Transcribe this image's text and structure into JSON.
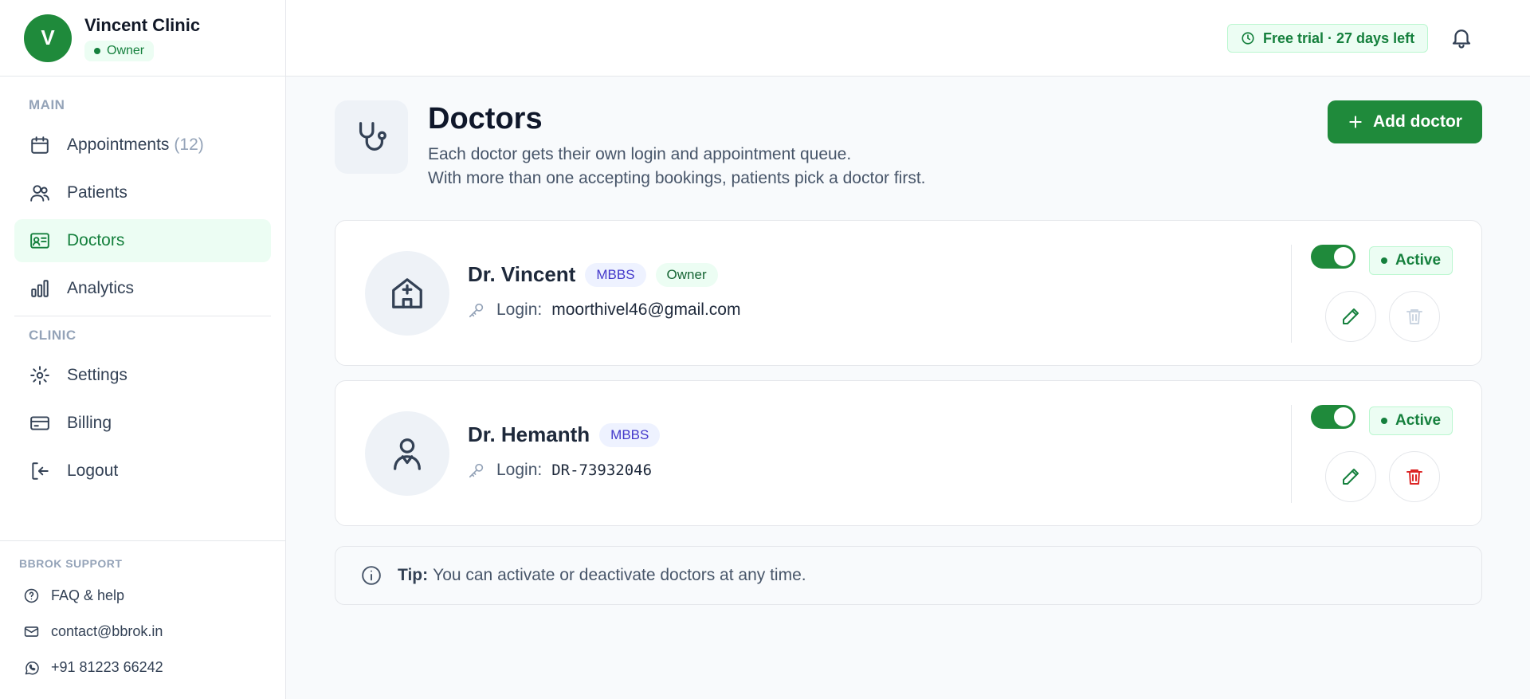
{
  "clinic": {
    "initial": "V",
    "name": "Vincent Clinic",
    "role": "Owner"
  },
  "sidebar": {
    "main_label": "MAIN",
    "clinic_label": "CLINIC",
    "items": [
      {
        "label": "Appointments",
        "count": "(12)",
        "icon": "calendar-icon"
      },
      {
        "label": "Patients",
        "icon": "users-icon"
      },
      {
        "label": "Doctors",
        "icon": "id-card-icon",
        "active": true
      },
      {
        "label": "Analytics",
        "icon": "bar-chart-icon"
      },
      {
        "label": "Settings",
        "icon": "gear-icon"
      },
      {
        "label": "Billing",
        "icon": "credit-card-icon"
      },
      {
        "label": "Logout",
        "icon": "logout-icon"
      }
    ],
    "support": {
      "label": "BBROK SUPPORT",
      "faq": "FAQ & help",
      "email": "contact@bbrok.in",
      "phone": "+91 81223 66242"
    }
  },
  "topbar": {
    "trial": "Free trial · 27 days left"
  },
  "page": {
    "title": "Doctors",
    "subtitle_line1": "Each doctor gets their own login and appointment queue.",
    "subtitle_line2": "With more than one accepting bookings, patients pick a doctor first.",
    "add_button": "Add doctor"
  },
  "doctors": [
    {
      "name": "Dr. Vincent",
      "degree": "MBBS",
      "role_badge": "Owner",
      "login_label": "Login:",
      "login": "moorthivel46@gmail.com",
      "status": "Active",
      "enabled": true,
      "delete_disabled": true
    },
    {
      "name": "Dr. Hemanth",
      "degree": "MBBS",
      "login_label": "Login:",
      "login": "DR-73932046",
      "status": "Active",
      "enabled": true,
      "delete_disabled": false
    }
  ],
  "tip": {
    "label": "Tip:",
    "text": "You can activate or deactivate doctors at any time."
  },
  "colors": {
    "brand": "#1f8a3b",
    "danger": "#dc2626",
    "degree_text": "#4338ca"
  }
}
